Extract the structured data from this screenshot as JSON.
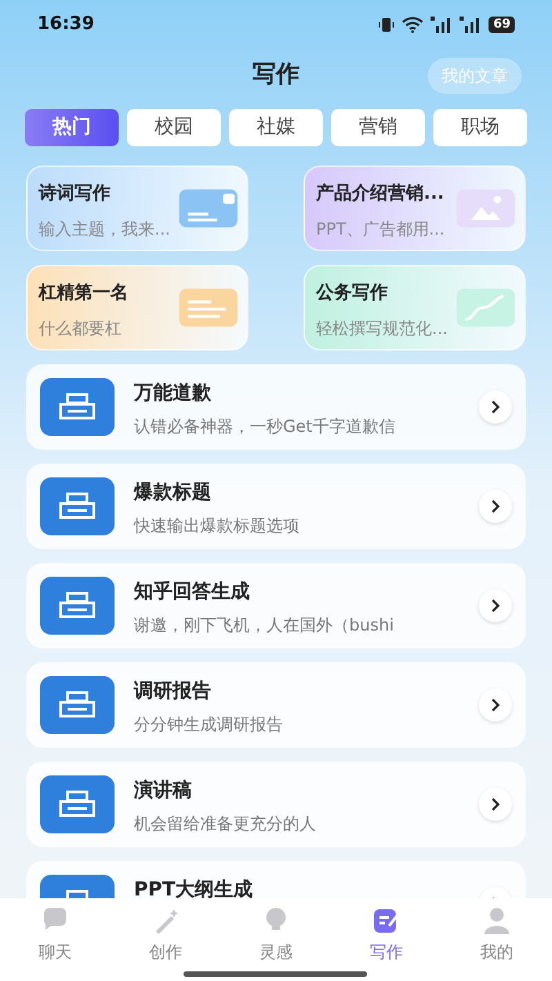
{
  "status_bar": {
    "time": "16:39",
    "battery": "69"
  },
  "header": {
    "title": "写作",
    "my_articles": "我的文章"
  },
  "tabs": [
    {
      "label": "热门",
      "selected": true
    },
    {
      "label": "校园",
      "selected": false
    },
    {
      "label": "社媒",
      "selected": false
    },
    {
      "label": "营销",
      "selected": false
    },
    {
      "label": "职场",
      "selected": false
    }
  ],
  "featured": [
    {
      "title": "诗词写作",
      "subtitle": "输入主题，我来...",
      "color": "#bcdcfb",
      "kind": "card"
    },
    {
      "title": "产品介绍营销...",
      "subtitle": "PPT、广告都用...",
      "color": "#d6c8fb",
      "kind": "image"
    },
    {
      "title": "杠精第一名",
      "subtitle": "什么都要杠",
      "color": "#fde0b8",
      "kind": "lines"
    },
    {
      "title": "公务写作",
      "subtitle": "轻松撰写规范化...",
      "color": "#bff0e0",
      "kind": "wave"
    }
  ],
  "tools": [
    {
      "title": "万能道歉",
      "subtitle": "认错必备神器，一秒Get千字道歉信"
    },
    {
      "title": "爆款标题",
      "subtitle": "快速输出爆款标题选项"
    },
    {
      "title": "知乎回答生成",
      "subtitle": "谢邀，刚下飞机，人在国外（bushi"
    },
    {
      "title": "调研报告",
      "subtitle": "分分钟生成调研报告"
    },
    {
      "title": "演讲稿",
      "subtitle": "机会留给准备更充分的人"
    },
    {
      "title": "PPT大纲生成"
    }
  ],
  "nav": [
    {
      "label": "聊天",
      "selected": false,
      "kind": "chat"
    },
    {
      "label": "创作",
      "selected": false,
      "kind": "wand"
    },
    {
      "label": "灵感",
      "selected": false,
      "kind": "bulb"
    },
    {
      "label": "写作",
      "selected": true,
      "kind": "write"
    },
    {
      "label": "我的",
      "selected": false,
      "kind": "person"
    }
  ]
}
